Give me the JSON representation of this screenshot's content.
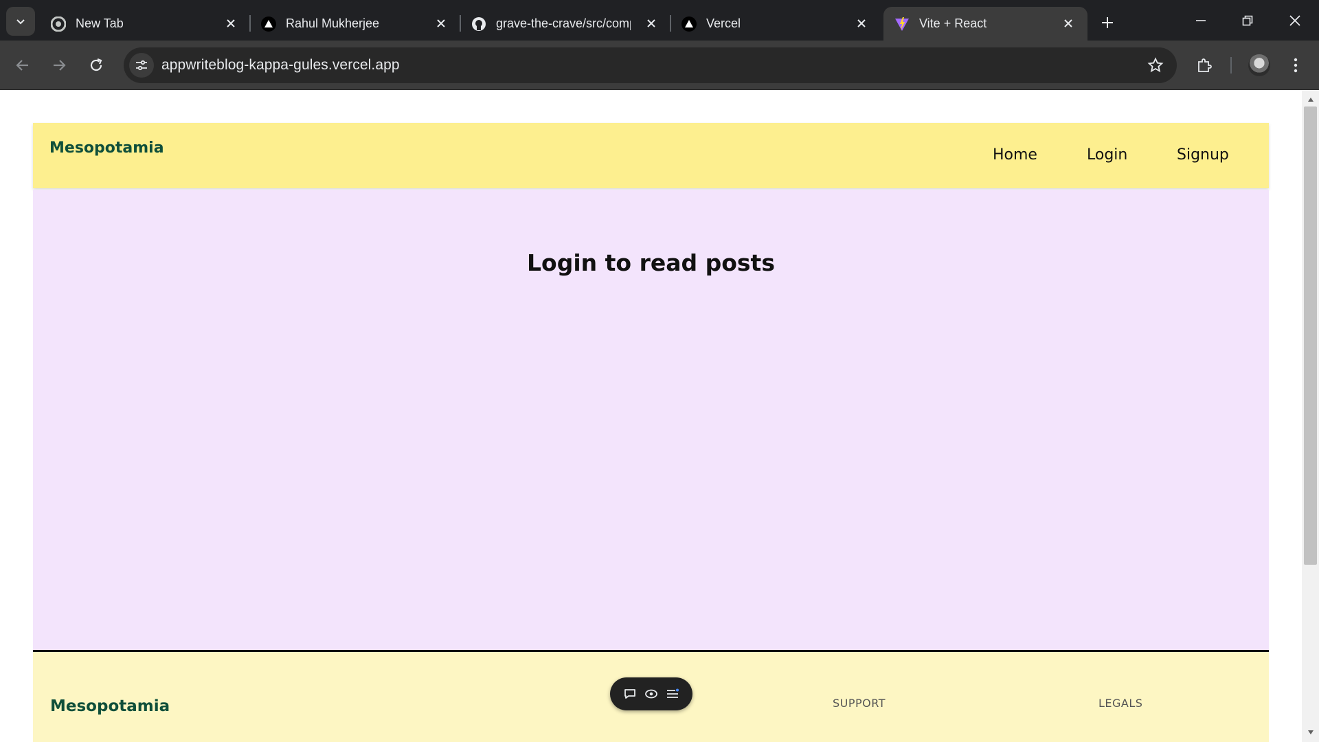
{
  "browser": {
    "tabs": [
      {
        "title": "New Tab",
        "favicon": "chrome-icon"
      },
      {
        "title": "Rahul Mukherjee",
        "favicon": "vercel-triangle-icon"
      },
      {
        "title": "grave-the-crave/src/comp",
        "favicon": "github-icon"
      },
      {
        "title": "Vercel",
        "favicon": "vercel-triangle-icon"
      },
      {
        "title": "Vite + React",
        "favicon": "vite-icon",
        "active": true
      }
    ],
    "url": "appwriteblog-kappa-gules.vercel.app"
  },
  "site": {
    "brand": "Mesopotamia",
    "nav": [
      {
        "label": "Home"
      },
      {
        "label": "Login"
      },
      {
        "label": "Signup"
      }
    ],
    "main_heading": "Login to read posts",
    "footer": {
      "brand": "Mesopotamia",
      "support_heading": "SUPPORT",
      "legals_heading": "LEGALS"
    }
  },
  "colors": {
    "header_bg": "#fdef8f",
    "main_bg": "#f3e4fc",
    "footer_bg": "#fdf6c3",
    "brand_text": "#0f4f3a"
  }
}
